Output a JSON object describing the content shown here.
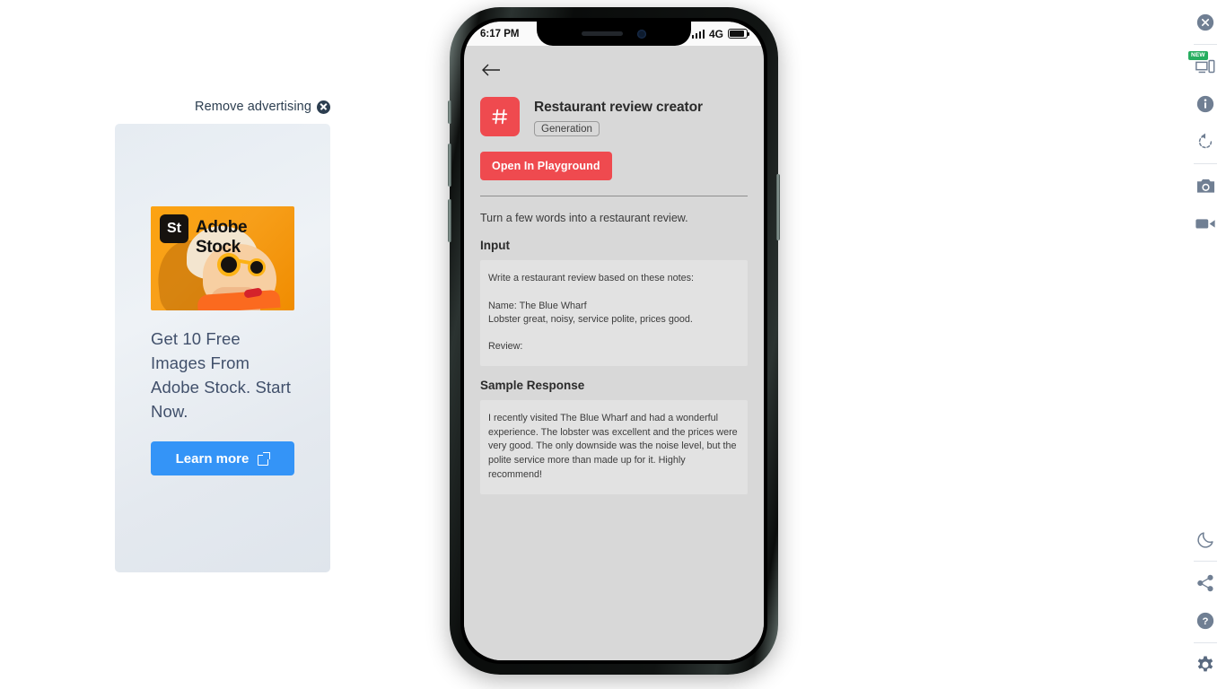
{
  "ad": {
    "remove_label": "Remove advertising",
    "close_icon": "close-circle-icon",
    "brand_mark": "St",
    "brand_name": "Adobe Stock",
    "headline": "Get 10 Free Images From Adobe Stock. Start Now.",
    "cta_label": "Learn more",
    "cta_icon": "external-link-icon",
    "cta_color": "#3494f7"
  },
  "phone": {
    "status": {
      "time": "6:17 PM",
      "network": "4G",
      "signal_icon": "signal-bars-icon",
      "battery_icon": "battery-icon"
    },
    "back_icon": "arrow-left-icon",
    "app": {
      "icon_name": "hash-icon",
      "icon_color": "#ef4a4f",
      "title": "Restaurant review creator",
      "tag": "Generation",
      "primary_button": "Open In Playground",
      "primary_button_color": "#ef4a4f",
      "description": "Turn a few words into a restaurant review.",
      "input_section_title": "Input",
      "input_text": "Write a restaurant review based on these notes:\n\nName: The Blue Wharf\nLobster great, noisy, service polite, prices good.\n\nReview:",
      "response_section_title": "Sample Response",
      "response_text": "I recently visited The Blue Wharf and had a wonderful experience. The lobster was excellent and the prices were very good. The only downside was the noise level, but the polite service more than made up for it. Highly recommend!"
    }
  },
  "toolbar": {
    "items": [
      {
        "name": "close-icon",
        "label": "Close"
      },
      {
        "name": "device-icon",
        "label": "Device",
        "badge": "NEW"
      },
      {
        "name": "info-icon",
        "label": "Info"
      },
      {
        "name": "rotate-icon",
        "label": "Rotate"
      },
      {
        "name": "camera-icon",
        "label": "Screenshot"
      },
      {
        "name": "video-icon",
        "label": "Record"
      },
      {
        "name": "moon-icon",
        "label": "Dark mode"
      },
      {
        "name": "share-icon",
        "label": "Share"
      },
      {
        "name": "help-icon",
        "label": "Help"
      },
      {
        "name": "settings-icon",
        "label": "Settings"
      }
    ]
  }
}
